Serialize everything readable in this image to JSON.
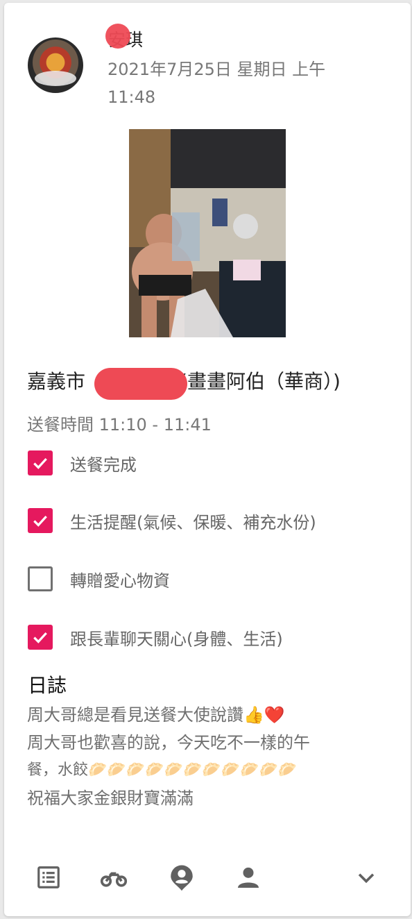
{
  "post": {
    "author_name": "安琪",
    "timestamp": "2021年7月25日 星期日 上午 11:48"
  },
  "recipient": {
    "city": "嘉義市",
    "name": "(畫畫阿伯（華商）)"
  },
  "delivery_time": "送餐時間 11:10 - 11:41",
  "checklist": [
    {
      "label": "送餐完成",
      "checked": true
    },
    {
      "label": "生活提醒(氣候、保暖、補充水份)",
      "checked": true
    },
    {
      "label": "轉贈愛心物資",
      "checked": false
    },
    {
      "label": "跟長輩聊天關心(身體、生活)",
      "checked": true
    }
  ],
  "log": {
    "title": "日誌",
    "lines": [
      "周大哥總是看見送餐大使說讚👍❤️",
      "周大哥也歡喜的說，今天吃不一樣的午",
      "餐，水餃🥟🥟🥟🥟🥟🥟🥟🥟🥟🥟🥟",
      "祝福大家金銀財寶滿滿"
    ]
  },
  "nav": {
    "icons": [
      "list-icon",
      "motorcycle-icon",
      "location-person-icon",
      "person-icon",
      "chevron-down-icon"
    ]
  },
  "colors": {
    "accent": "#e5195e",
    "redaction": "#ee4a55",
    "icon_gray": "#616161"
  }
}
